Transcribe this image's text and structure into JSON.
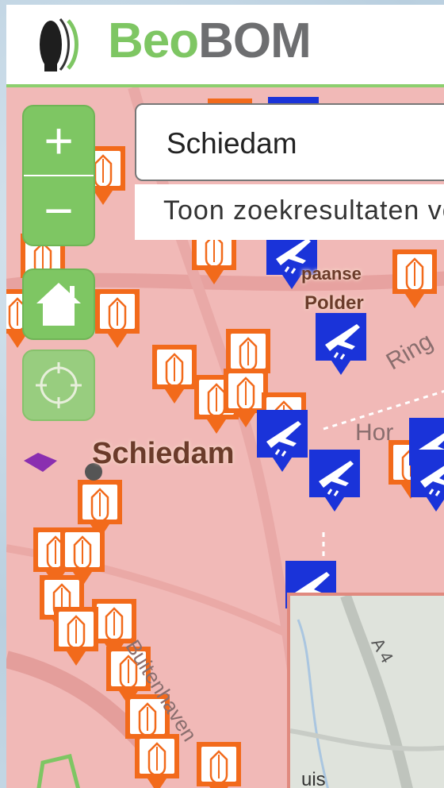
{
  "app": {
    "brand_part1": "Beo",
    "brand_part2": "BOM"
  },
  "colors": {
    "brand_green": "#7ec663",
    "brand_gray": "#6d6e70",
    "map_overlay": "#f1b9b7",
    "bomb_marker": "#f26a1b",
    "plane_marker": "#1a33d9"
  },
  "controls": {
    "zoom_in": "+",
    "zoom_out": "−",
    "home_icon": "home-icon",
    "locate_icon": "crosshair-icon"
  },
  "search": {
    "value": "Schiedam",
    "results_hint": "Toon zoekresultaten vo"
  },
  "map": {
    "labels": {
      "city": "Schiedam",
      "district_1": "paanse",
      "district_2": "Polder",
      "road_1": "Ring",
      "road_2": "Hor",
      "road_3": "Buitenhaven",
      "inset_road": "A 4",
      "inset_text": "uis"
    }
  }
}
